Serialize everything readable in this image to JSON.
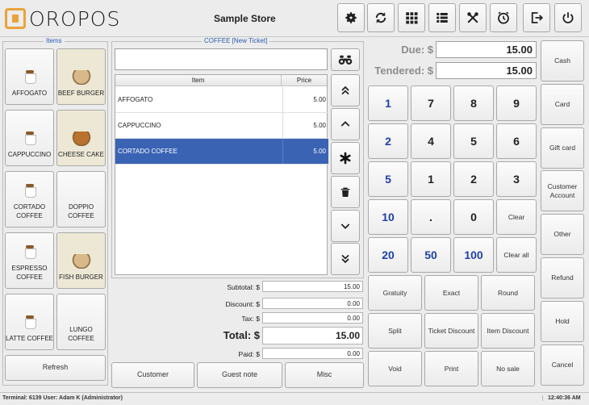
{
  "app": {
    "logo_text": "OROPOS",
    "store_name": "Sample Store"
  },
  "toolbar": {
    "icons": [
      "gear-icon",
      "refresh-icon",
      "grid-icon",
      "list-icon",
      "tools-icon",
      "clock-icon",
      "logout-icon",
      "power-icon"
    ]
  },
  "items_panel": {
    "title": "Items",
    "items": [
      {
        "label": "AFFOGATO",
        "kind": "coffee"
      },
      {
        "label": "BEEF BURGER",
        "kind": "food"
      },
      {
        "label": "CAPPUCCINO",
        "kind": "coffee"
      },
      {
        "label": "CHEESE CAKE",
        "kind": "food"
      },
      {
        "label": "CORTADO COFFEE",
        "kind": "coffee"
      },
      {
        "label": "DOPPIO COFFEE",
        "kind": "plain"
      },
      {
        "label": "ESPRESSO COFFEE",
        "kind": "coffee"
      },
      {
        "label": "FISH BURGER",
        "kind": "food"
      },
      {
        "label": "LATTE COFFEE",
        "kind": "coffee"
      },
      {
        "label": "LUNGO COFFEE",
        "kind": "plain"
      }
    ],
    "refresh_label": "Refresh"
  },
  "ticket": {
    "title": "COFFEE [New Ticket]",
    "search_value": "",
    "columns": {
      "item": "Item",
      "price": "Price"
    },
    "rows": [
      {
        "name": "AFFOGATO",
        "price": "5.00",
        "selected": false
      },
      {
        "name": "CAPPUCCINO",
        "price": "5.00",
        "selected": false
      },
      {
        "name": "CORTADO COFFEE",
        "price": "5.00",
        "selected": true
      }
    ],
    "summary": {
      "subtotal_label": "Subtotal: $",
      "subtotal": "15.00",
      "discount_label": "Discount: $",
      "discount": "0.00",
      "tax_label": "Tax: $",
      "tax": "0.00",
      "total_label": "Total: $",
      "total": "15.00",
      "paid_label": "Paid: $",
      "paid": "0.00"
    },
    "buttons": {
      "customer": "Customer",
      "guest_note": "Guest note",
      "misc": "Misc"
    }
  },
  "payment": {
    "due_label": "Due: $",
    "due": "15.00",
    "tendered_label": "Tendered: $",
    "tendered": "15.00",
    "keys": [
      [
        "1",
        "7",
        "8",
        "9"
      ],
      [
        "2",
        "4",
        "5",
        "6"
      ],
      [
        "5",
        "1",
        "2",
        "3"
      ],
      [
        "10",
        ".",
        "0",
        "Clear"
      ],
      [
        "20",
        "50",
        "100",
        "Clear all"
      ]
    ],
    "actions": [
      [
        "Gratuity",
        "Exact",
        "Round"
      ],
      [
        "Split",
        "Ticket Discount",
        "Item Discount"
      ],
      [
        "Void",
        "Print",
        "No sale"
      ]
    ],
    "side_buttons": [
      "Cash",
      "Card",
      "Gift card",
      "Customer Account",
      "Other",
      "Refund",
      "Hold",
      "Cancel"
    ]
  },
  "status": {
    "left": "Terminal: 6139 User: Adam K (Administrator)",
    "time": "12:40:36 AM"
  },
  "colors": {
    "accent": "#2a5db0",
    "selection": "#3a63b4",
    "logo_orange": "#e8a33a"
  }
}
